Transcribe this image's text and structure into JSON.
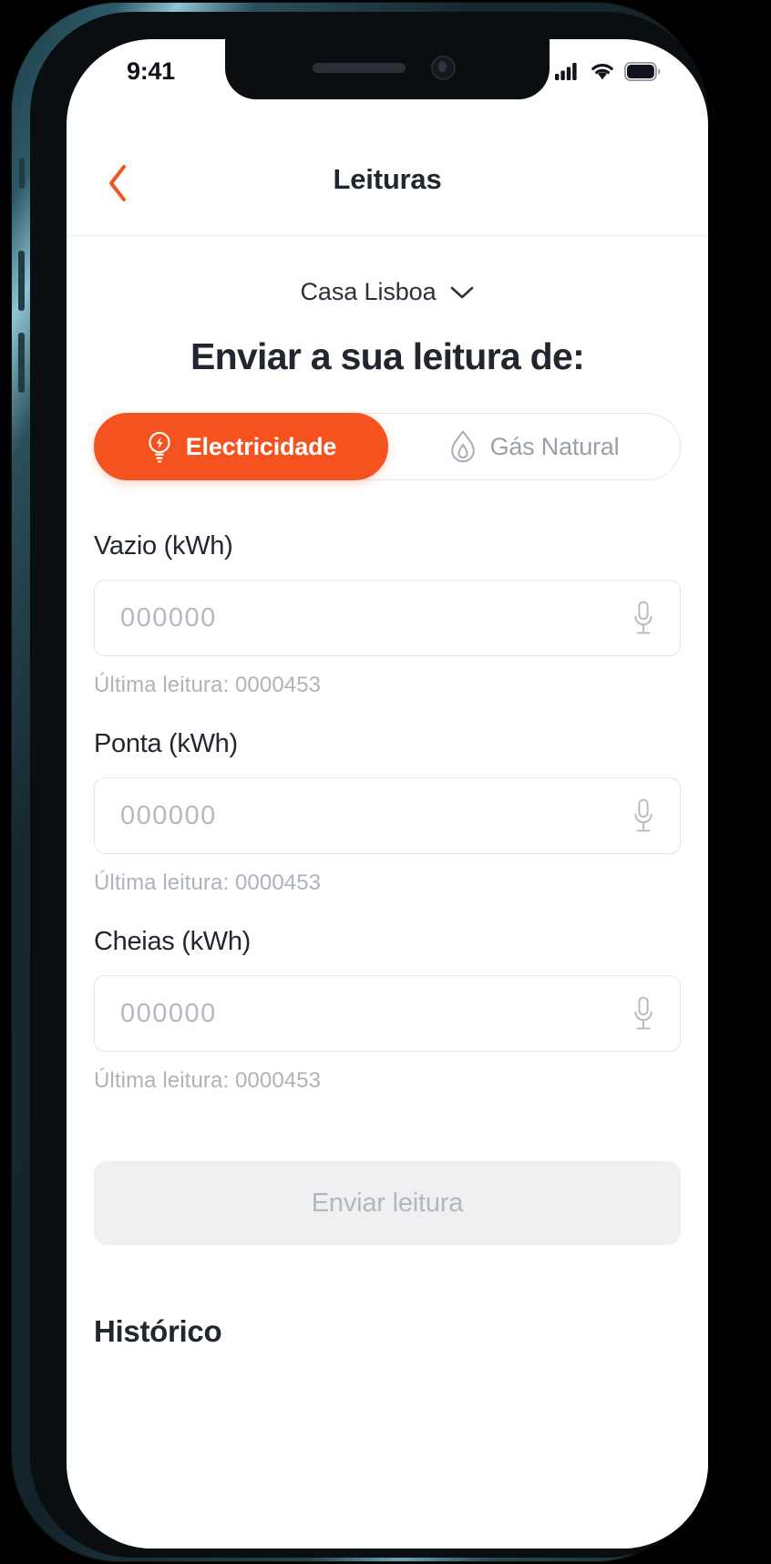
{
  "statusbar": {
    "time": "9:41",
    "cellular_icon": "cellular-signal-icon",
    "wifi_icon": "wifi-icon",
    "battery_icon": "battery-full-icon"
  },
  "navbar": {
    "back_icon": "chevron-left-icon",
    "title": "Leituras"
  },
  "house_selector": {
    "label": "Casa Lisboa",
    "chevron_icon": "chevron-down-icon"
  },
  "heading": "Enviar a sua leitura de:",
  "tabs": [
    {
      "label": "Electricidade",
      "icon": "lightbulb-icon",
      "active": true
    },
    {
      "label": "Gás Natural",
      "icon": "flame-icon",
      "active": false
    }
  ],
  "fields": [
    {
      "label": "Vazio (kWh)",
      "value": "",
      "placeholder": "000000",
      "hint": "Última leitura: 0000453",
      "mic_icon": "microphone-icon"
    },
    {
      "label": "Ponta (kWh)",
      "value": "",
      "placeholder": "000000",
      "hint": "Última leitura: 0000453",
      "mic_icon": "microphone-icon"
    },
    {
      "label": "Cheias (kWh)",
      "value": "",
      "placeholder": "000000",
      "hint": "Última leitura: 0000453",
      "mic_icon": "microphone-icon"
    }
  ],
  "submit": {
    "label": "Enviar leitura",
    "enabled": false
  },
  "history": {
    "title": "Histórico"
  },
  "colors": {
    "accent": "#F4531F",
    "text_primary": "#22262E",
    "text_muted": "#AEB3BA",
    "border": "#E3E5E8",
    "disabled_bg": "#EFF0F2"
  }
}
